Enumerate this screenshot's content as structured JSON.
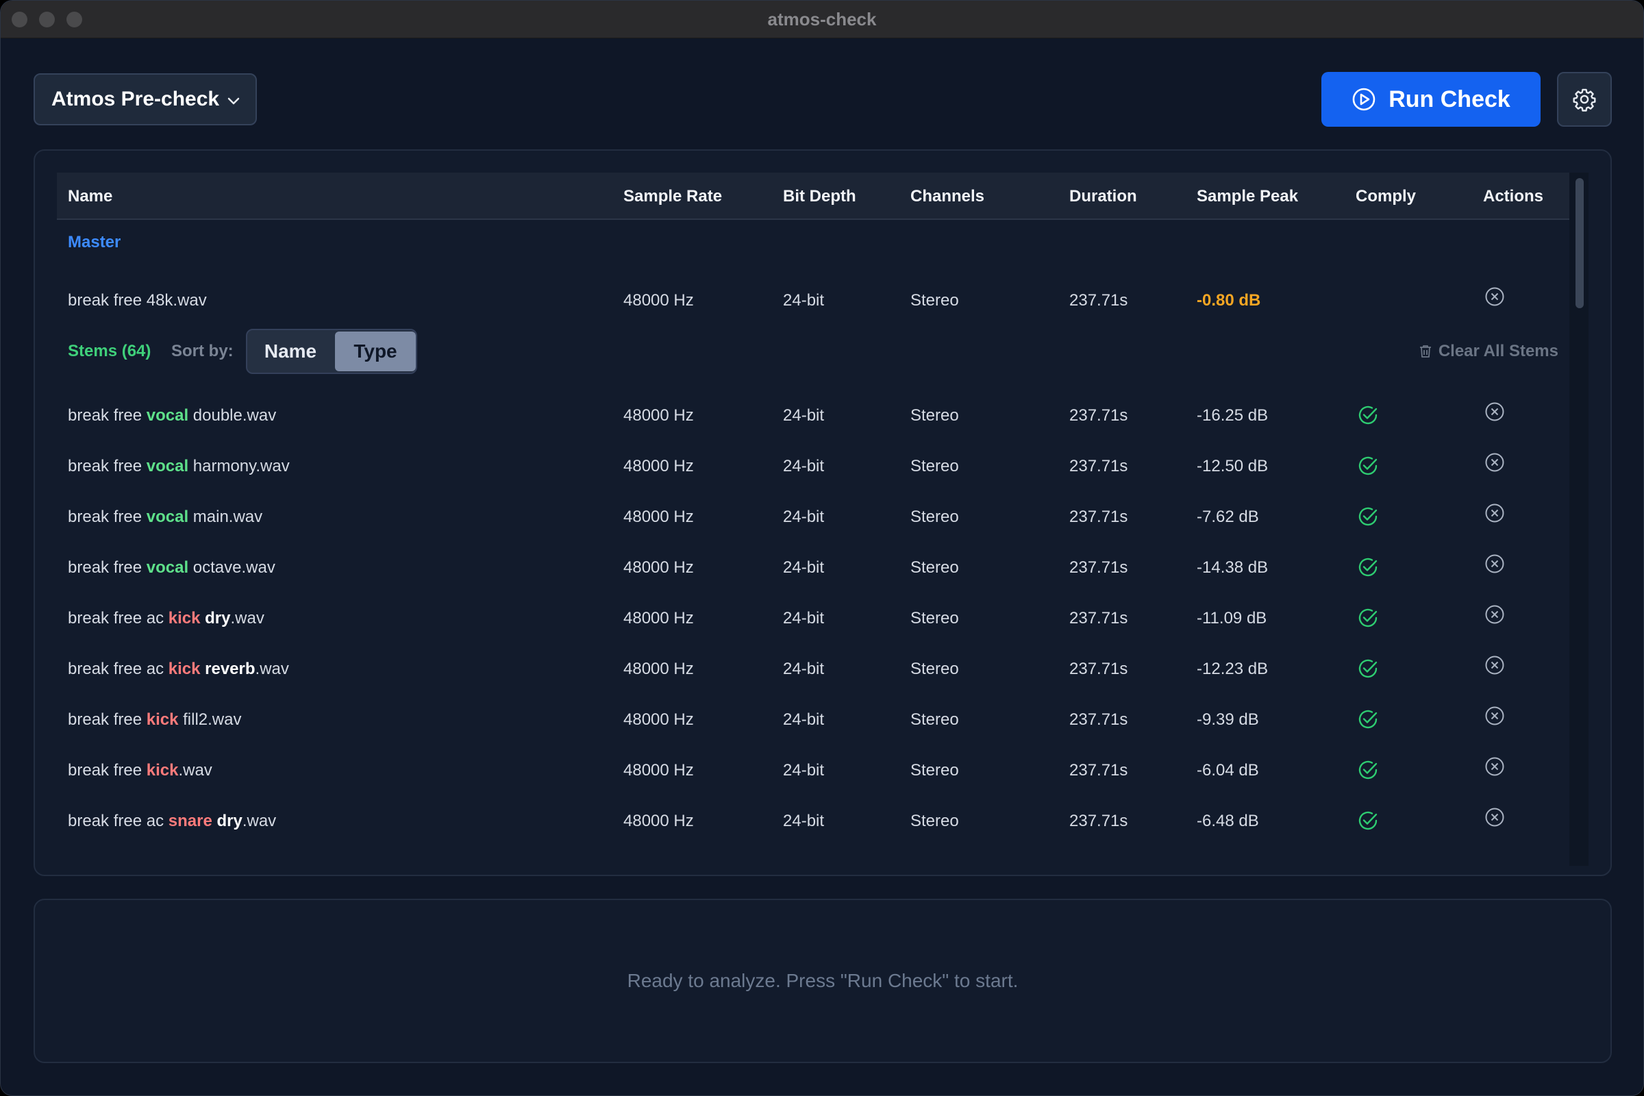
{
  "window": {
    "title": "atmos-check"
  },
  "toolbar": {
    "profile_label": "Atmos Pre-check",
    "run_label": "Run Check",
    "settings_icon": "gear-icon"
  },
  "table": {
    "headers": [
      "Name",
      "Sample Rate",
      "Bit Depth",
      "Channels",
      "Duration",
      "Sample Peak",
      "Comply",
      "Actions"
    ],
    "master": {
      "section_label": "Master",
      "row": {
        "name": "break free 48k.wav",
        "rate": "48000 Hz",
        "bits": "24-bit",
        "channels": "Stereo",
        "duration": "237.71s",
        "peak": "-0.80 dB"
      }
    },
    "stems": {
      "label": "Stems (64)",
      "sort_by_label": "Sort by:",
      "sort_options": [
        "Name",
        "Type"
      ],
      "sort_selected": "Type",
      "clear_label": "Clear All Stems",
      "rows": [
        {
          "parts": [
            {
              "t": "break free ",
              "k": ""
            },
            {
              "t": "vocal",
              "k": "vocal"
            },
            {
              "t": " double.wav",
              "k": ""
            }
          ],
          "rate": "48000 Hz",
          "bits": "24-bit",
          "channels": "Stereo",
          "duration": "237.71s",
          "peak": "-16.25 dB"
        },
        {
          "parts": [
            {
              "t": "break free ",
              "k": ""
            },
            {
              "t": "vocal",
              "k": "vocal"
            },
            {
              "t": " harmony.wav",
              "k": ""
            }
          ],
          "rate": "48000 Hz",
          "bits": "24-bit",
          "channels": "Stereo",
          "duration": "237.71s",
          "peak": "-12.50 dB"
        },
        {
          "parts": [
            {
              "t": "break free ",
              "k": ""
            },
            {
              "t": "vocal",
              "k": "vocal"
            },
            {
              "t": " main.wav",
              "k": ""
            }
          ],
          "rate": "48000 Hz",
          "bits": "24-bit",
          "channels": "Stereo",
          "duration": "237.71s",
          "peak": "-7.62 dB"
        },
        {
          "parts": [
            {
              "t": "break free ",
              "k": ""
            },
            {
              "t": "vocal",
              "k": "vocal"
            },
            {
              "t": " octave.wav",
              "k": ""
            }
          ],
          "rate": "48000 Hz",
          "bits": "24-bit",
          "channels": "Stereo",
          "duration": "237.71s",
          "peak": "-14.38 dB"
        },
        {
          "parts": [
            {
              "t": "break free ac ",
              "k": ""
            },
            {
              "t": "kick",
              "k": "drum"
            },
            {
              "t": " ",
              "k": ""
            },
            {
              "t": "dry",
              "k": "plain"
            },
            {
              "t": ".wav",
              "k": ""
            }
          ],
          "rate": "48000 Hz",
          "bits": "24-bit",
          "channels": "Stereo",
          "duration": "237.71s",
          "peak": "-11.09 dB"
        },
        {
          "parts": [
            {
              "t": "break free ac ",
              "k": ""
            },
            {
              "t": "kick",
              "k": "drum"
            },
            {
              "t": " ",
              "k": ""
            },
            {
              "t": "reverb",
              "k": "plain"
            },
            {
              "t": ".wav",
              "k": ""
            }
          ],
          "rate": "48000 Hz",
          "bits": "24-bit",
          "channels": "Stereo",
          "duration": "237.71s",
          "peak": "-12.23 dB"
        },
        {
          "parts": [
            {
              "t": "break free ",
              "k": ""
            },
            {
              "t": "kick",
              "k": "drum"
            },
            {
              "t": " fill2.wav",
              "k": ""
            }
          ],
          "rate": "48000 Hz",
          "bits": "24-bit",
          "channels": "Stereo",
          "duration": "237.71s",
          "peak": "-9.39 dB"
        },
        {
          "parts": [
            {
              "t": "break free ",
              "k": ""
            },
            {
              "t": "kick",
              "k": "drum"
            },
            {
              "t": ".wav",
              "k": ""
            }
          ],
          "rate": "48000 Hz",
          "bits": "24-bit",
          "channels": "Stereo",
          "duration": "237.71s",
          "peak": "-6.04 dB"
        },
        {
          "parts": [
            {
              "t": "break free ac ",
              "k": ""
            },
            {
              "t": "snare",
              "k": "drum"
            },
            {
              "t": " ",
              "k": ""
            },
            {
              "t": "dry",
              "k": "plain"
            },
            {
              "t": ".wav",
              "k": ""
            }
          ],
          "rate": "48000 Hz",
          "bits": "24-bit",
          "channels": "Stereo",
          "duration": "237.71s",
          "peak": "-6.48 dB"
        }
      ]
    }
  },
  "status": {
    "message": "Ready to analyze. Press \"Run Check\" to start."
  },
  "colors": {
    "accent": "#1462f0",
    "master_label": "#3d8bff",
    "stems_label": "#3fd07a",
    "vocal_keyword": "#5ee08a",
    "drum_keyword": "#ff7b7b",
    "peak_warning": "#f5a623",
    "comply_ok": "#2ecc71"
  }
}
